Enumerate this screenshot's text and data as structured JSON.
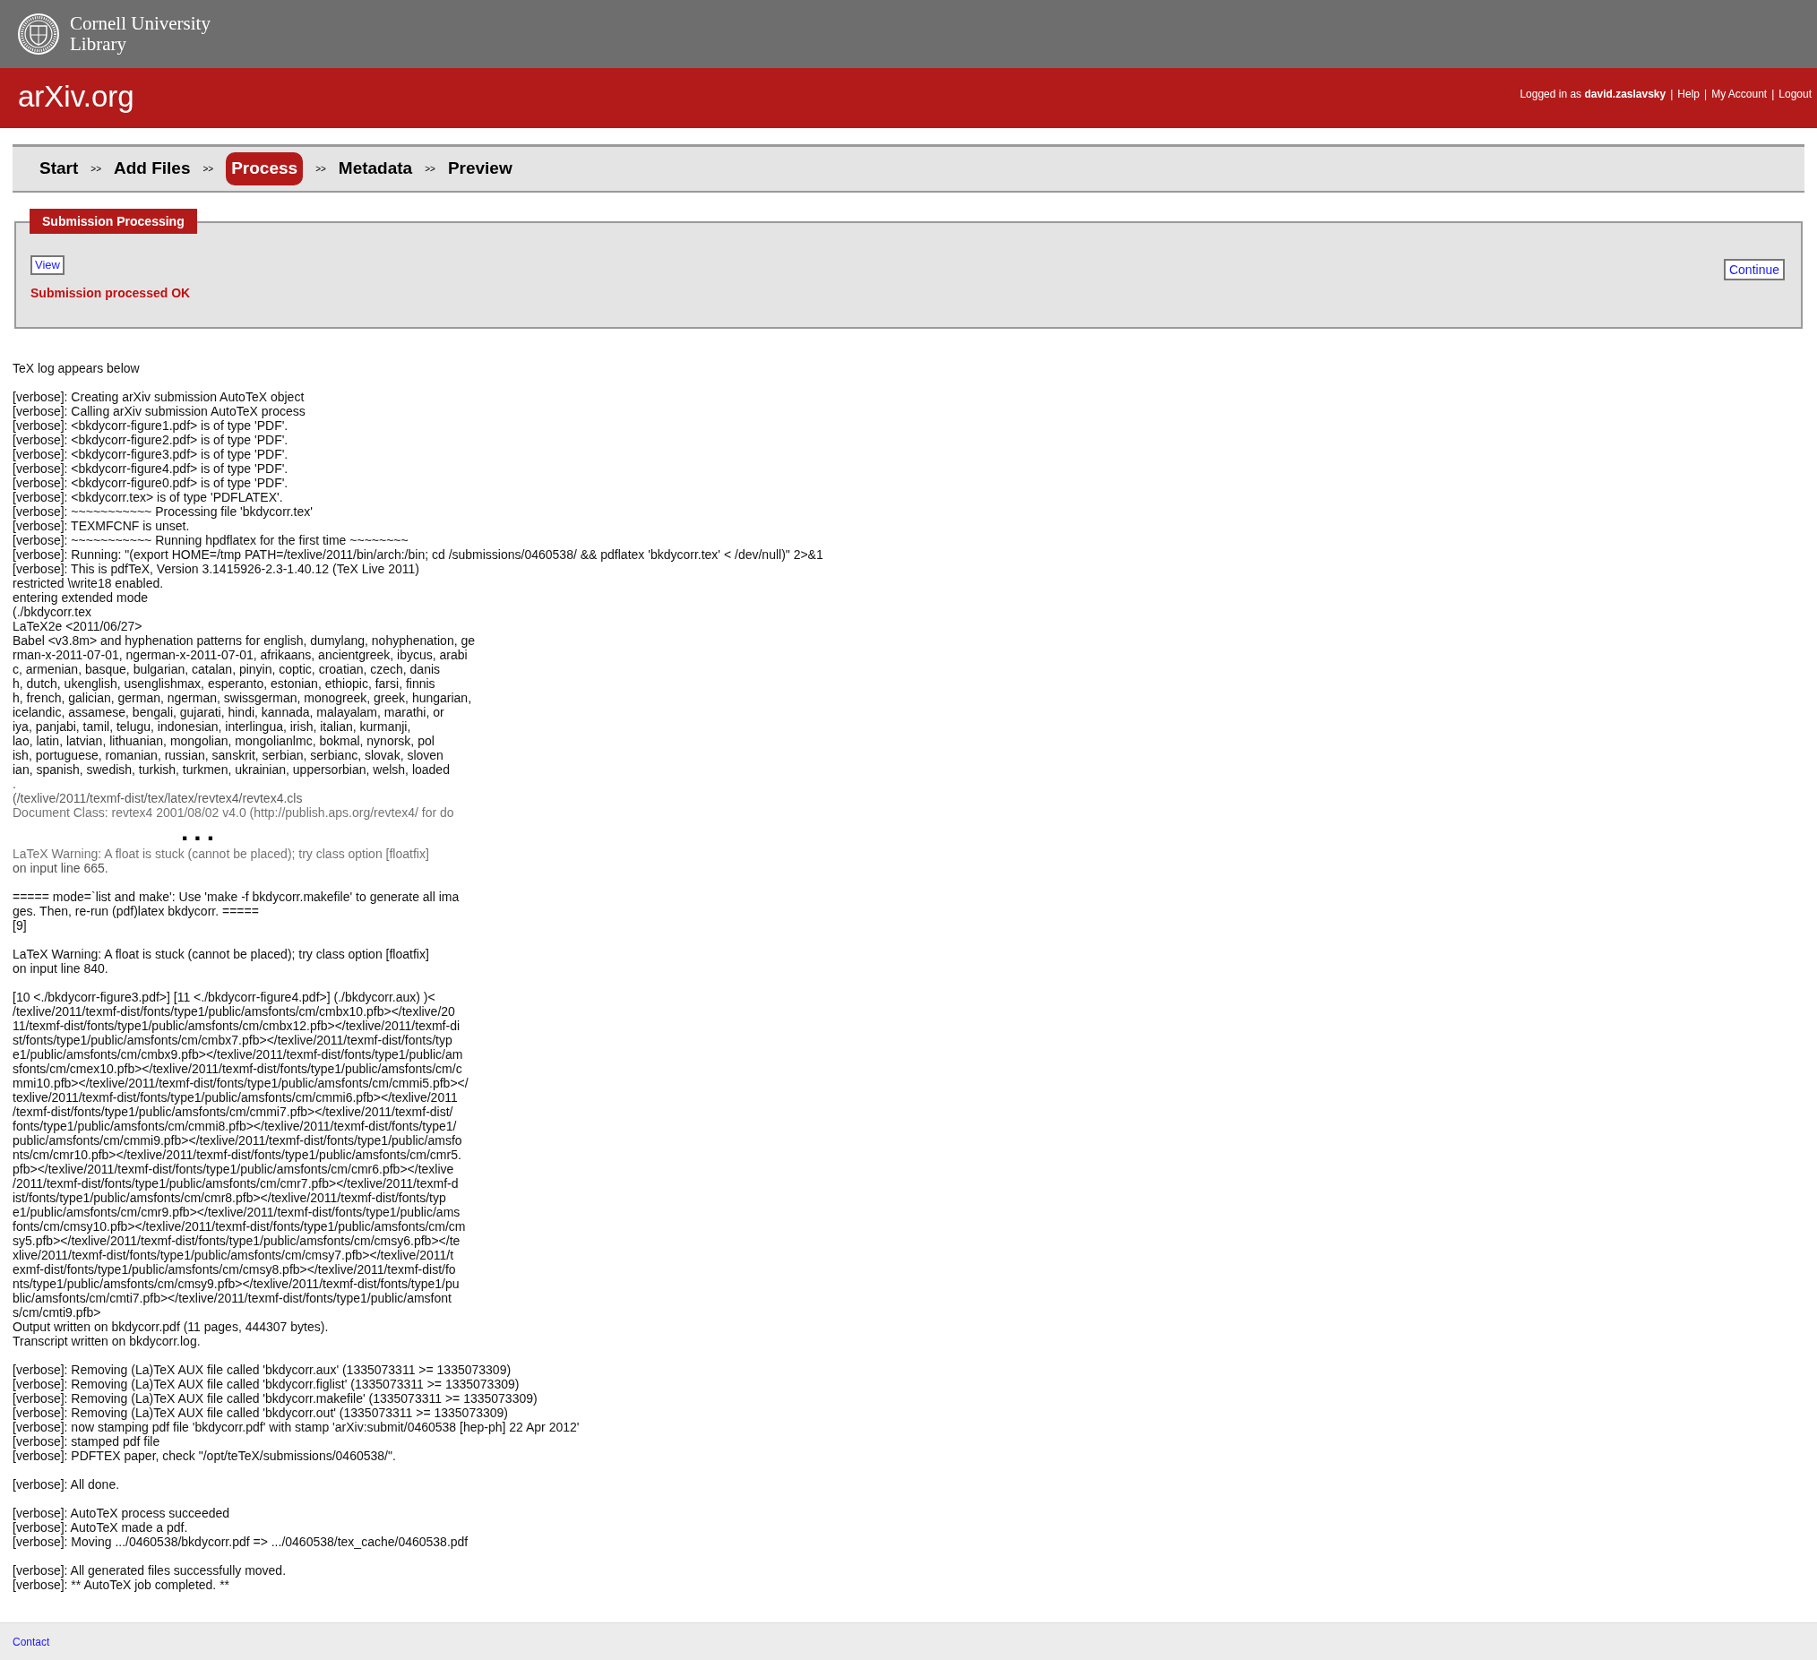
{
  "header": {
    "institution_line1": "Cornell University",
    "institution_line2": "Library"
  },
  "site": {
    "title": "arXiv.org",
    "user_bar": {
      "prefix": "Logged in as",
      "username": "david.zaslavsky",
      "separator": "|",
      "links": [
        "Help",
        "My Account",
        "Logout"
      ]
    }
  },
  "steps": [
    {
      "label": "Start",
      "selected": false,
      "separator": ">>"
    },
    {
      "label": "Add Files",
      "selected": false,
      "separator": ">>"
    },
    {
      "label": "Process",
      "selected": true,
      "separator": ">>"
    },
    {
      "label": "Metadata",
      "selected": false,
      "separator": ">>"
    },
    {
      "label": "Preview",
      "selected": false
    }
  ],
  "panel": {
    "legend": "Submission Processing",
    "view_button": "View",
    "continue_button": "Continue",
    "status": "Submission processed OK"
  },
  "log": [
    {
      "kind": "text",
      "lines": [
        "TeX log appears below"
      ]
    },
    {
      "kind": "text",
      "lines": [
        "[verbose]: Creating arXiv submission AutoTeX object",
        "[verbose]: Calling arXiv submission AutoTeX process",
        "[verbose]: <bkdycorr-figure1.pdf> is of type 'PDF'.",
        "[verbose]: <bkdycorr-figure2.pdf> is of type 'PDF'.",
        "[verbose]: <bkdycorr-figure3.pdf> is of type 'PDF'.",
        "[verbose]: <bkdycorr-figure4.pdf> is of type 'PDF'.",
        "[verbose]: <bkdycorr-figure0.pdf> is of type 'PDF'.",
        "[verbose]: <bkdycorr.tex> is of type 'PDFLATEX'.",
        "[verbose]: ~~~~~~~~~~~ Processing file 'bkdycorr.tex'",
        "[verbose]: TEXMFCNF is unset.",
        "[verbose]: ~~~~~~~~~~~ Running hpdflatex for the first time ~~~~~~~~",
        "[verbose]: Running: \"(export HOME=/tmp PATH=/texlive/2011/bin/arch:/bin; cd /submissions/0460538/ && pdflatex 'bkdycorr.tex' < /dev/null)\" 2>&1",
        "[verbose]: This is pdfTeX, Version 3.1415926-2.3-1.40.12 (TeX Live 2011)",
        "restricted \\write18 enabled.",
        "entering extended mode",
        "(./bkdycorr.tex",
        "LaTeX2e <2011/06/27>",
        "Babel <v3.8m> and hyphenation patterns for english, dumylang, nohyphenation, ge",
        "rman-x-2011-07-01, ngerman-x-2011-07-01, afrikaans, ancientgreek, ibycus, arabi",
        "c, armenian, basque, bulgarian, catalan, pinyin, coptic, croatian, czech, danis",
        "h, dutch, ukenglish, usenglishmax, esperanto, estonian, ethiopic, farsi, finnis",
        "h, french, galician, german, ngerman, swissgerman, monogreek, greek, hungarian,",
        "icelandic, assamese, bengali, gujarati, hindi, kannada, malayalam, marathi, or",
        "iya, panjabi, tamil, telugu, indonesian, interlingua, irish, italian, kurmanji,",
        "lao, latin, latvian, lithuanian, mongolian, mongolianlmc, bokmal, nynorsk, pol",
        "ish, portuguese, romanian, russian, sanskrit, serbian, serbianc, slovak, sloven",
        "ian, spanish, swedish, turkish, turkmen, ukrainian, uppersorbian, welsh, loaded"
      ]
    },
    {
      "kind": "fade_out",
      "lines": [
        ".",
        "(/texlive/2011/texmf-dist/tex/latex/revtex4/revtex4.cls",
        "Document Class: revtex4 2001/08/02 v4.0 (http://publish.aps.org/revtex4/ for do"
      ]
    },
    {
      "kind": "ellipsis",
      "text": "..."
    },
    {
      "kind": "fade_in",
      "lines": [
        "LaTeX Warning: A float is stuck (cannot be placed); try class option [floatfix]",
        "on input line 665."
      ]
    },
    {
      "kind": "text",
      "lines": [
        "===== mode=`list and make': Use 'make -f bkdycorr.makefile' to generate all ima",
        "ges. Then, re-run (pdf)latex bkdycorr. =====",
        "[9]"
      ]
    },
    {
      "kind": "text",
      "lines": [
        "LaTeX Warning: A float is stuck (cannot be placed); try class option [floatfix]",
        "on input line 840."
      ]
    },
    {
      "kind": "text",
      "lines": [
        "[10 <./bkdycorr-figure3.pdf>] [11 <./bkdycorr-figure4.pdf>] (./bkdycorr.aux) )<",
        "/texlive/2011/texmf-dist/fonts/type1/public/amsfonts/cm/cmbx10.pfb></texlive/20",
        "11/texmf-dist/fonts/type1/public/amsfonts/cm/cmbx12.pfb></texlive/2011/texmf-di",
        "st/fonts/type1/public/amsfonts/cm/cmbx7.pfb></texlive/2011/texmf-dist/fonts/typ",
        "e1/public/amsfonts/cm/cmbx9.pfb></texlive/2011/texmf-dist/fonts/type1/public/am",
        "sfonts/cm/cmex10.pfb></texlive/2011/texmf-dist/fonts/type1/public/amsfonts/cm/c",
        "mmi10.pfb></texlive/2011/texmf-dist/fonts/type1/public/amsfonts/cm/cmmi5.pfb></",
        "texlive/2011/texmf-dist/fonts/type1/public/amsfonts/cm/cmmi6.pfb></texlive/2011",
        "/texmf-dist/fonts/type1/public/amsfonts/cm/cmmi7.pfb></texlive/2011/texmf-dist/",
        "fonts/type1/public/amsfonts/cm/cmmi8.pfb></texlive/2011/texmf-dist/fonts/type1/",
        "public/amsfonts/cm/cmmi9.pfb></texlive/2011/texmf-dist/fonts/type1/public/amsfo",
        "nts/cm/cmr10.pfb></texlive/2011/texmf-dist/fonts/type1/public/amsfonts/cm/cmr5.",
        "pfb></texlive/2011/texmf-dist/fonts/type1/public/amsfonts/cm/cmr6.pfb></texlive",
        "/2011/texmf-dist/fonts/type1/public/amsfonts/cm/cmr7.pfb></texlive/2011/texmf-d",
        "ist/fonts/type1/public/amsfonts/cm/cmr8.pfb></texlive/2011/texmf-dist/fonts/typ",
        "e1/public/amsfonts/cm/cmr9.pfb></texlive/2011/texmf-dist/fonts/type1/public/ams",
        "fonts/cm/cmsy10.pfb></texlive/2011/texmf-dist/fonts/type1/public/amsfonts/cm/cm",
        "sy5.pfb></texlive/2011/texmf-dist/fonts/type1/public/amsfonts/cm/cmsy6.pfb></te",
        "xlive/2011/texmf-dist/fonts/type1/public/amsfonts/cm/cmsy7.pfb></texlive/2011/t",
        "exmf-dist/fonts/type1/public/amsfonts/cm/cmsy8.pfb></texlive/2011/texmf-dist/fo",
        "nts/type1/public/amsfonts/cm/cmsy9.pfb></texlive/2011/texmf-dist/fonts/type1/pu",
        "blic/amsfonts/cm/cmti7.pfb></texlive/2011/texmf-dist/fonts/type1/public/amsfont",
        "s/cm/cmti9.pfb>",
        "Output written on bkdycorr.pdf (11 pages, 444307 bytes).",
        "Transcript written on bkdycorr.log."
      ]
    },
    {
      "kind": "text",
      "lines": [
        "[verbose]: Removing (La)TeX AUX file called 'bkdycorr.aux' (1335073311 >= 1335073309)",
        "[verbose]: Removing (La)TeX AUX file called 'bkdycorr.figlist' (1335073311 >= 1335073309)",
        "[verbose]: Removing (La)TeX AUX file called 'bkdycorr.makefile' (1335073311 >= 1335073309)",
        "[verbose]: Removing (La)TeX AUX file called 'bkdycorr.out' (1335073311 >= 1335073309)",
        "[verbose]: now stamping pdf file 'bkdycorr.pdf' with stamp 'arXiv:submit/0460538 [hep-ph] 22 Apr 2012'",
        "[verbose]: stamped pdf file",
        "[verbose]: PDFTEX paper, check \"/opt/teTeX/submissions/0460538/\"."
      ]
    },
    {
      "kind": "text",
      "lines": [
        "[verbose]: All done."
      ]
    },
    {
      "kind": "text",
      "lines": [
        "[verbose]: AutoTeX process succeeded",
        "[verbose]: AutoTeX made a pdf.",
        "[verbose]: Moving .../0460538/bkdycorr.pdf => .../0460538/tex_cache/0460538.pdf"
      ]
    },
    {
      "kind": "text",
      "lines": [
        "[verbose]: All generated files successfully moved.",
        "[verbose]: ** AutoTeX job completed. **"
      ]
    }
  ],
  "footer": {
    "link": "Contact"
  }
}
